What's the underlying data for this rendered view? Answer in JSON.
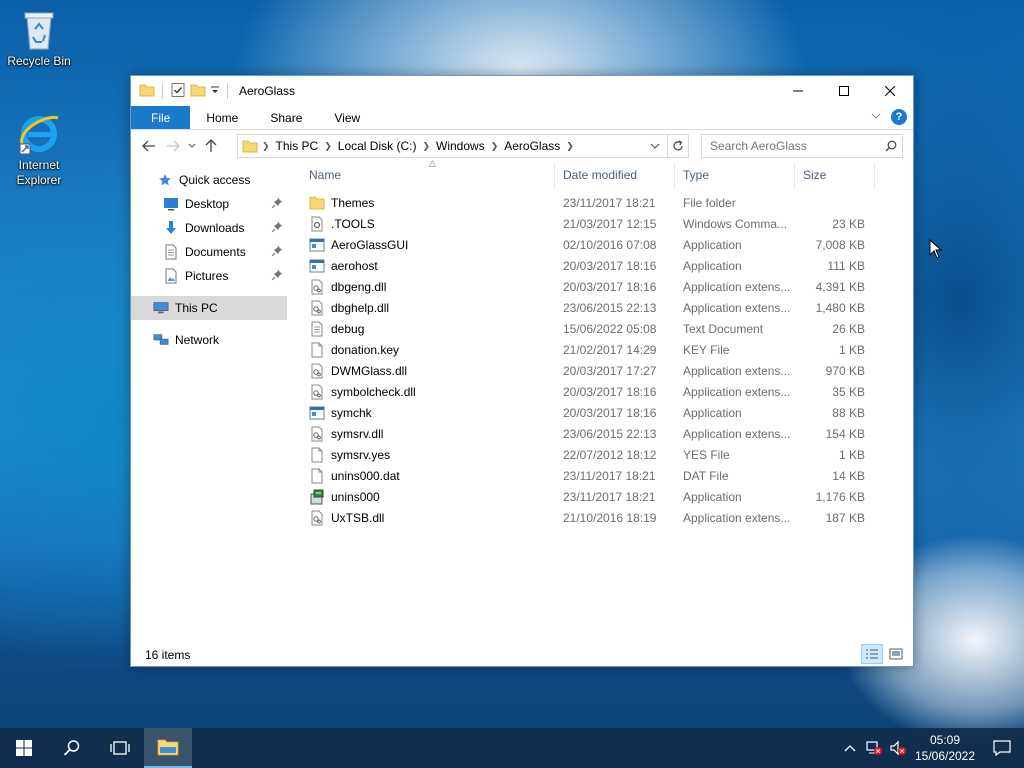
{
  "desktop": {
    "icons": [
      {
        "label": "Recycle Bin",
        "icon": "recycle-bin-icon"
      },
      {
        "label": "Internet Explorer",
        "icon": "internet-explorer-icon"
      }
    ]
  },
  "window": {
    "title": "AeroGlass",
    "controls": {
      "minimize": "minimize-icon",
      "maximize": "maximize-icon",
      "close": "close-icon"
    },
    "ribbon_tabs": [
      "File",
      "Home",
      "Share",
      "View"
    ],
    "address": {
      "crumbs": [
        "This PC",
        "Local Disk (C:)",
        "Windows",
        "AeroGlass"
      ]
    },
    "search": {
      "placeholder": "Search AeroGlass"
    },
    "nav_pane": [
      {
        "label": "Quick access",
        "icon": "star-icon",
        "pinned": false
      },
      {
        "label": "Desktop",
        "icon": "desktop-icon",
        "pinned": true
      },
      {
        "label": "Downloads",
        "icon": "download-arrow-icon",
        "pinned": true
      },
      {
        "label": "Documents",
        "icon": "document-icon",
        "pinned": true
      },
      {
        "label": "Pictures",
        "icon": "pictures-icon",
        "pinned": true
      },
      {
        "label": "This PC",
        "icon": "computer-icon",
        "pinned": false,
        "selected": true
      },
      {
        "label": "Network",
        "icon": "network-icon",
        "pinned": false
      }
    ],
    "columns": [
      "Name",
      "Date modified",
      "Type",
      "Size"
    ],
    "files": [
      {
        "name": "Themes",
        "date": "23/11/2017 18:21",
        "type": "File folder",
        "size": "",
        "icon": "folder-icon"
      },
      {
        "name": ".TOOLS",
        "date": "21/03/2017 12:15",
        "type": "Windows Comma...",
        "size": "23 KB",
        "icon": "settings-file-icon"
      },
      {
        "name": "AeroGlassGUI",
        "date": "02/10/2016 07:08",
        "type": "Application",
        "size": "7,008 KB",
        "icon": "application-icon"
      },
      {
        "name": "aerohost",
        "date": "20/03/2017 18:16",
        "type": "Application",
        "size": "111 KB",
        "icon": "application-icon"
      },
      {
        "name": "dbgeng.dll",
        "date": "20/03/2017 18:16",
        "type": "Application extens...",
        "size": "4,391 KB",
        "icon": "dll-file-icon"
      },
      {
        "name": "dbghelp.dll",
        "date": "23/06/2015 22:13",
        "type": "Application extens...",
        "size": "1,480 KB",
        "icon": "dll-file-icon"
      },
      {
        "name": "debug",
        "date": "15/06/2022 05:08",
        "type": "Text Document",
        "size": "26 KB",
        "icon": "text-file-icon"
      },
      {
        "name": "donation.key",
        "date": "21/02/2017 14:29",
        "type": "KEY File",
        "size": "1 KB",
        "icon": "blank-file-icon"
      },
      {
        "name": "DWMGlass.dll",
        "date": "20/03/2017 17:27",
        "type": "Application extens...",
        "size": "970 KB",
        "icon": "dll-file-icon"
      },
      {
        "name": "symbolcheck.dll",
        "date": "20/03/2017 18:16",
        "type": "Application extens...",
        "size": "35 KB",
        "icon": "dll-file-icon"
      },
      {
        "name": "symchk",
        "date": "20/03/2017 18:16",
        "type": "Application",
        "size": "88 KB",
        "icon": "application-icon"
      },
      {
        "name": "symsrv.dll",
        "date": "23/06/2015 22:13",
        "type": "Application extens...",
        "size": "154 KB",
        "icon": "dll-file-icon"
      },
      {
        "name": "symsrv.yes",
        "date": "22/07/2012 18:12",
        "type": "YES File",
        "size": "1 KB",
        "icon": "blank-file-icon"
      },
      {
        "name": "unins000.dat",
        "date": "23/11/2017 18:21",
        "type": "DAT File",
        "size": "14 KB",
        "icon": "blank-file-icon"
      },
      {
        "name": "unins000",
        "date": "23/11/2017 18:21",
        "type": "Application",
        "size": "1,176 KB",
        "icon": "uninstaller-icon"
      },
      {
        "name": "UxTSB.dll",
        "date": "21/10/2016 18:19",
        "type": "Application extens...",
        "size": "187 KB",
        "icon": "dll-file-icon"
      }
    ],
    "status": {
      "item_count": "16 items"
    }
  },
  "taskbar": {
    "clock_time": "05:09",
    "clock_date": "15/06/2022"
  },
  "colors": {
    "accent": "#1979ca",
    "selection": "#d9d9d9",
    "folder": "#f8d775",
    "taskbar": "#102c4a"
  }
}
